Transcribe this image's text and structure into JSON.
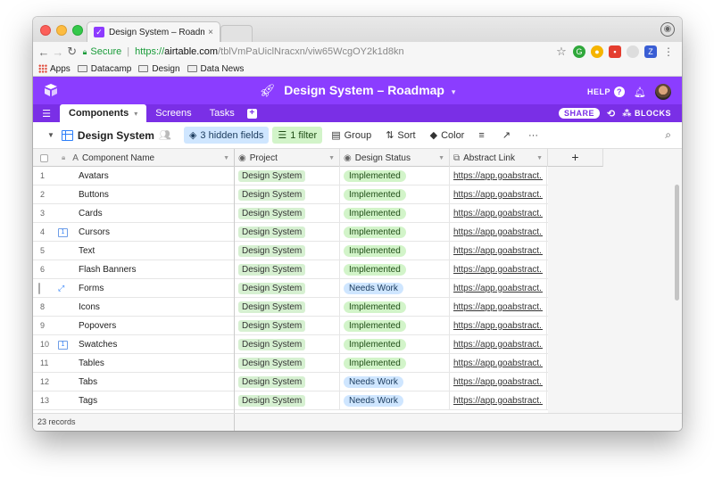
{
  "browser": {
    "tab_title": "Design System – Roadmap: Co",
    "tab_close": "×",
    "secure_label": "Secure",
    "url_scheme": "https://",
    "url_domain": "airtable.com",
    "url_path": "/tblVmPaUiclNracxn/viw65WcgOY2k1d8kn",
    "bookmarks": [
      {
        "label": "Apps",
        "icon": "apps-grid-icon"
      },
      {
        "label": "Datacamp",
        "icon": "folder-icon"
      },
      {
        "label": "Design",
        "icon": "folder-icon"
      },
      {
        "label": "Data News",
        "icon": "folder-icon"
      }
    ]
  },
  "header": {
    "title": "Design System – Roadmap",
    "help_label": "HELP",
    "accent_color": "#8b3dff"
  },
  "tabs": {
    "items": [
      "Components",
      "Screens",
      "Tasks"
    ],
    "share_label": "SHARE",
    "blocks_label": "BLOCKS"
  },
  "toolbar": {
    "view_name": "Design System",
    "hidden_fields_label": "3 hidden fields",
    "filter_label": "1 filter",
    "group_label": "Group",
    "sort_label": "Sort",
    "color_label": "Color",
    "more_label": "···"
  },
  "grid": {
    "columns": {
      "name": "Component Name",
      "project": "Project",
      "status": "Design Status",
      "link": "Abstract Link",
      "add": "+"
    },
    "rows": [
      {
        "num": "1",
        "name": "Avatars",
        "project": "Design System",
        "status": "Implemented",
        "status_kind": "implemented",
        "link": "https://app.goabstract...",
        "comments": ""
      },
      {
        "num": "2",
        "name": "Buttons",
        "project": "Design System",
        "status": "Implemented",
        "status_kind": "implemented",
        "link": "https://app.goabstract...",
        "comments": ""
      },
      {
        "num": "3",
        "name": "Cards",
        "project": "Design System",
        "status": "Implemented",
        "status_kind": "implemented",
        "link": "https://app.goabstract...",
        "comments": ""
      },
      {
        "num": "4",
        "name": "Cursors",
        "project": "Design System",
        "status": "Implemented",
        "status_kind": "implemented",
        "link": "https://app.goabstract...",
        "comments": "1"
      },
      {
        "num": "5",
        "name": "Text",
        "project": "Design System",
        "status": "Implemented",
        "status_kind": "implemented",
        "link": "https://app.goabstract...",
        "comments": ""
      },
      {
        "num": "6",
        "name": "Flash Banners",
        "project": "Design System",
        "status": "Implemented",
        "status_kind": "implemented",
        "link": "https://app.goabstract...",
        "comments": ""
      },
      {
        "num": "",
        "name": "Forms",
        "project": "Design System",
        "status": "Needs Work",
        "status_kind": "needs",
        "link": "https://app.goabstract...",
        "comments": "",
        "hover": true
      },
      {
        "num": "8",
        "name": "Icons",
        "project": "Design System",
        "status": "Implemented",
        "status_kind": "implemented",
        "link": "https://app.goabstract...",
        "comments": ""
      },
      {
        "num": "9",
        "name": "Popovers",
        "project": "Design System",
        "status": "Implemented",
        "status_kind": "implemented",
        "link": "https://app.goabstract...",
        "comments": ""
      },
      {
        "num": "10",
        "name": "Swatches",
        "project": "Design System",
        "status": "Implemented",
        "status_kind": "implemented",
        "link": "https://app.goabstract...",
        "comments": "1"
      },
      {
        "num": "11",
        "name": "Tables",
        "project": "Design System",
        "status": "Implemented",
        "status_kind": "implemented",
        "link": "https://app.goabstract...",
        "comments": ""
      },
      {
        "num": "12",
        "name": "Tabs",
        "project": "Design System",
        "status": "Needs Work",
        "status_kind": "needs",
        "link": "https://app.goabstract...",
        "comments": ""
      },
      {
        "num": "13",
        "name": "Tags",
        "project": "Design System",
        "status": "Needs Work",
        "status_kind": "needs",
        "link": "https://app.goabstract...",
        "comments": ""
      }
    ],
    "record_count": "23 records"
  }
}
